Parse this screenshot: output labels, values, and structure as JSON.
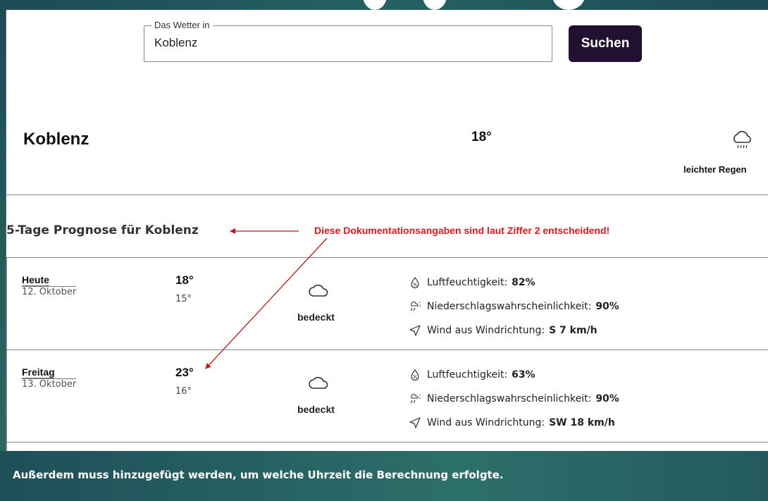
{
  "search": {
    "legend": "Das Wetter in",
    "value": "Koblenz",
    "button_label": "Suchen"
  },
  "current": {
    "city": "Koblenz",
    "temperature": "18°",
    "condition": "leichter Regen",
    "icon": "cloud-rain-icon"
  },
  "forecast": {
    "title": "5-Tage Prognose für Koblenz",
    "days": [
      {
        "name": "Heute",
        "date": "12. Oktober",
        "max": "18°",
        "min": "15°",
        "condition": "bedeckt",
        "icon": "cloud-icon",
        "humidity_label": "Luftfeuchtigkeit:",
        "humidity_value": "82%",
        "precip_label": "Niederschlagswahrscheinlichkeit:",
        "precip_value": "90%",
        "wind_label": "Wind aus Windrichtung:",
        "wind_value": "S 7 km/h"
      },
      {
        "name": "Freitag",
        "date": "13. Oktober",
        "max": "23°",
        "min": "16°",
        "condition": "bedeckt",
        "icon": "cloud-icon",
        "humidity_label": "Luftfeuchtigkeit:",
        "humidity_value": "63%",
        "precip_label": "Niederschlagswahrscheinlichkeit:",
        "precip_value": "90%",
        "wind_label": "Wind aus Windrichtung:",
        "wind_value": "SW 18 km/h"
      }
    ]
  },
  "annotation": {
    "text": "Diese Dokumentationsangaben sind laut Ziffer 2 entscheidend!",
    "color": "#e01818"
  },
  "footer": {
    "text": "Außerdem muss hinzugefügt werden, um welche Uhrzeit die Berechnung erfolgte."
  },
  "colors": {
    "button_bg": "#221033",
    "slide_band": "#1f4f55"
  }
}
